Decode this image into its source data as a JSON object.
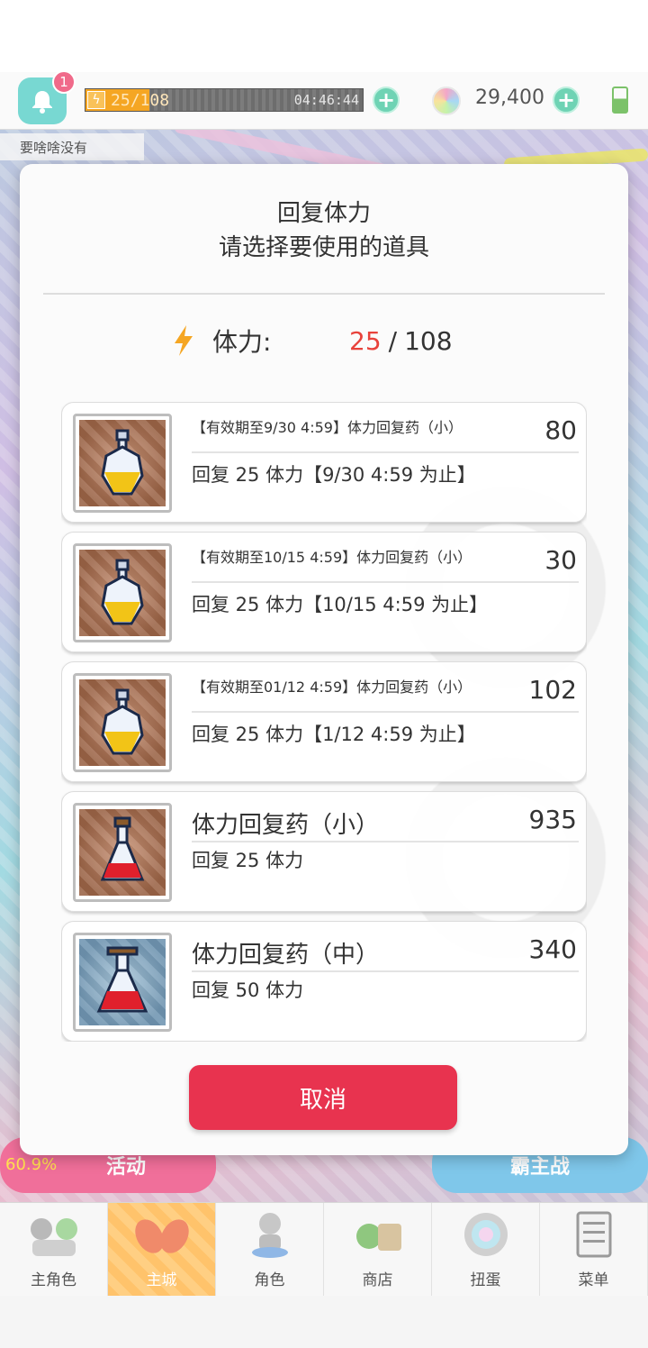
{
  "topbar": {
    "notification_count": "1",
    "stamina_current": "25",
    "stamina_max": "108",
    "stamina_timer": "04:46:44",
    "stamina_fraction": 0.231,
    "gems": "29,400"
  },
  "chat": {
    "text": "要啥啥没有"
  },
  "background": {
    "left_button_percent": "60.9%",
    "left_button_label": "活动",
    "right_button_label": "霸主战"
  },
  "modal": {
    "title": "回复体力",
    "subtitle": "请选择要使用的道具",
    "stamina_label": "体力:",
    "stamina_current": "25",
    "stamina_separator": "/",
    "stamina_max": "108",
    "cancel_label": "取消"
  },
  "items": [
    {
      "name": "【有效期至9/30 4:59】体力回复药（小）",
      "count": "80",
      "desc": "回复 25 体力【9/30 4:59 为止】",
      "style": "small",
      "potion": "yellow"
    },
    {
      "name": "【有效期至10/15 4:59】体力回复药（小）",
      "count": "30",
      "desc": "回复 25 体力【10/15 4:59 为止】",
      "style": "small",
      "potion": "yellow"
    },
    {
      "name": "【有效期至01/12 4:59】体力回复药（小）",
      "count": "102",
      "desc": "回复 25 体力【1/12 4:59 为止】",
      "style": "small",
      "potion": "yellow"
    },
    {
      "name": "体力回复药（小）",
      "count": "935",
      "desc": "回复 25 体力",
      "style": "large",
      "potion": "red"
    },
    {
      "name": "体力回复药（中）",
      "count": "340",
      "desc": "回复 50 体力",
      "style": "large",
      "potion": "red-large"
    }
  ],
  "bottom_nav": [
    {
      "label": "主角色",
      "icon": "hero-group-icon"
    },
    {
      "label": "主城",
      "icon": "castle-icon",
      "active": true
    },
    {
      "label": "角色",
      "icon": "character-icon"
    },
    {
      "label": "商店",
      "icon": "shop-icon"
    },
    {
      "label": "扭蛋",
      "icon": "gacha-icon"
    },
    {
      "label": "菜单",
      "icon": "menu-icon"
    }
  ],
  "colors": {
    "accent_red": "#e8334f",
    "stamina_red": "#e8423b",
    "stamina_orange": "#f5a623",
    "bell_teal": "#78d8d2",
    "plus_green": "#6fd3b4"
  }
}
